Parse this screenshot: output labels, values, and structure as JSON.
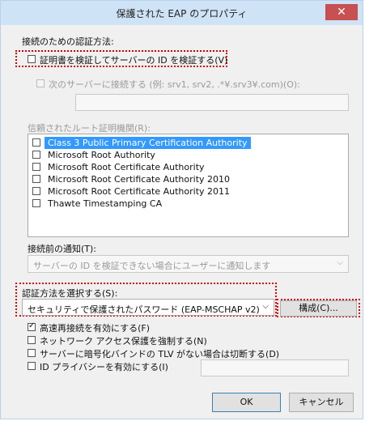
{
  "window": {
    "title": "保護された EAP のプロパティ",
    "close_glyph": "✕"
  },
  "auth_section": {
    "label": "接続のための認証方法:"
  },
  "verify_cert": {
    "label": "証明書を検証してサーバーの ID を検証する(V)",
    "checked": false
  },
  "connect_servers": {
    "label": "次のサーバーに接続する (例: srv1, srv2, .*¥.srv3¥.com)(O):",
    "value": ""
  },
  "trusted_ca": {
    "label": "信頼されたルート証明機関(R):",
    "items": [
      {
        "label": "Class 3 Public Primary Certification Authority",
        "selected": true
      },
      {
        "label": "Microsoft Root Authority",
        "selected": false
      },
      {
        "label": "Microsoft Root Certificate Authority",
        "selected": false
      },
      {
        "label": "Microsoft Root Certificate Authority 2010",
        "selected": false
      },
      {
        "label": "Microsoft Root Certificate Authority 2011",
        "selected": false
      },
      {
        "label": "Thawte Timestamping CA",
        "selected": false
      }
    ]
  },
  "notify": {
    "label": "接続前の通知(T):",
    "value": "サーバーの ID を検証できない場合にユーザーに通知します"
  },
  "auth_method": {
    "label": "認証方法を選択する(S):",
    "value": "セキュリティで保護されたパスワード (EAP-MSCHAP v2)",
    "configure_label": "構成(C)..."
  },
  "options": [
    {
      "label": "高速再接続を有効にする(F)",
      "checked": true
    },
    {
      "label": "ネットワーク アクセス保護を強制する(N)",
      "checked": false
    },
    {
      "label": "サーバーに暗号化バインドの TLV がない場合は切断する(D)",
      "checked": false
    },
    {
      "label": "ID プライバシーを有効にする(I)",
      "checked": false
    }
  ],
  "footer": {
    "ok_label": "OK",
    "cancel_label": "キャンセル"
  },
  "colors": {
    "highlight": "#d40000",
    "selection": "#3399ff",
    "titlebar": "#cfe3f7",
    "close": "#c75050"
  }
}
